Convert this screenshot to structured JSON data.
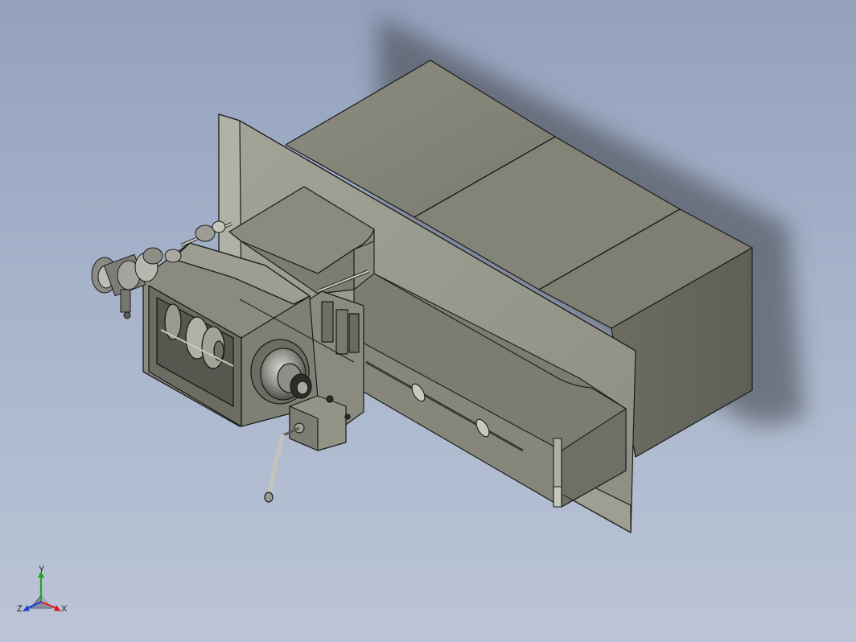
{
  "viewport": {
    "background_top": "#93a1bc",
    "background_bottom": "#bcc5d6"
  },
  "model": {
    "body_color": "#7d7f70",
    "face_dark": "#6e6f63",
    "face_light": "#9c9d90",
    "edge_color": "#1b1b1b"
  },
  "triad": {
    "x_label": "X",
    "y_label": "Y",
    "z_label": "Z",
    "x_color": "#d61f1f",
    "y_color": "#27a127",
    "z_color": "#1f3fd6"
  }
}
